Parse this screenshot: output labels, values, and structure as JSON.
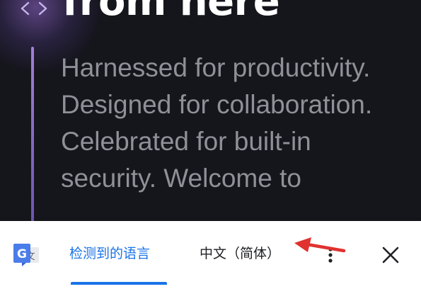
{
  "hero": {
    "heading": "from here",
    "body": "Harnessed for productivity. Designed for collaboration. Celebrated for built-in security. Welcome to",
    "icon": "code-icon",
    "colors": {
      "background": "#15151c",
      "accent": "#a47fd6",
      "body_text": "#8f9098"
    }
  },
  "translate_bar": {
    "app_icon": "google-translate-icon",
    "tabs": [
      {
        "label": "检测到的语言",
        "selected": true
      },
      {
        "label": "中文（简体）",
        "selected": false
      }
    ],
    "more_icon": "more-vert-icon",
    "close_icon": "close-icon",
    "annotation_icon": "red-arrow-icon",
    "colors": {
      "selected": "#1a73e8",
      "annotation": "#e0322f"
    }
  }
}
